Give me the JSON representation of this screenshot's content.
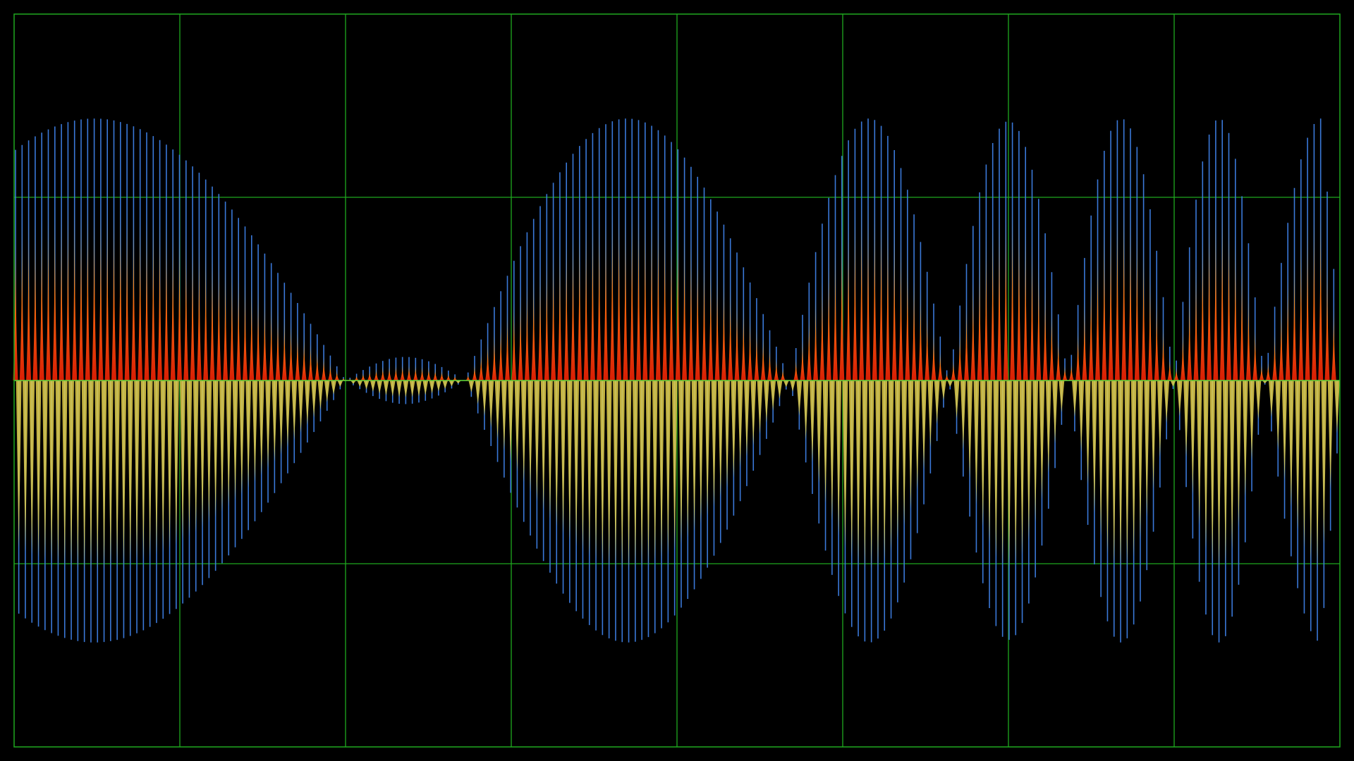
{
  "display": {
    "background": "#000000",
    "grid_color": "#1fa81f",
    "grid_divisions": {
      "horizontal": 8,
      "vertical": 4
    },
    "center_line_color": "#5fd23a"
  },
  "waveforms": [
    {
      "name": "magnitude",
      "gradient": [
        "#d81e05",
        "#f25a0c",
        "#f4a91c",
        "#f2d53c"
      ],
      "polarity": "positive"
    },
    {
      "name": "real",
      "color": "#3a78d8",
      "polarity": "bipolar"
    },
    {
      "name": "envelope-fill",
      "color": "#e3cf4a",
      "polarity": "negative"
    }
  ],
  "bursts": [
    {
      "start": 0.0,
      "end": 0.25,
      "amp": 1.0,
      "start_amp": 0.12
    },
    {
      "start": 0.25,
      "end": 0.34,
      "amp": 0.09
    },
    {
      "start": 0.34,
      "end": 0.585,
      "amp": 1.0
    },
    {
      "start": 0.585,
      "end": 0.705,
      "amp": 1.0
    },
    {
      "start": 0.705,
      "end": 0.795,
      "amp": 0.99
    },
    {
      "start": 0.795,
      "end": 0.875,
      "amp": 1.0
    },
    {
      "start": 0.875,
      "end": 0.943,
      "amp": 1.0
    },
    {
      "start": 0.943,
      "end": 1.0,
      "amp": 1.0,
      "end_amp": 0.13
    }
  ]
}
